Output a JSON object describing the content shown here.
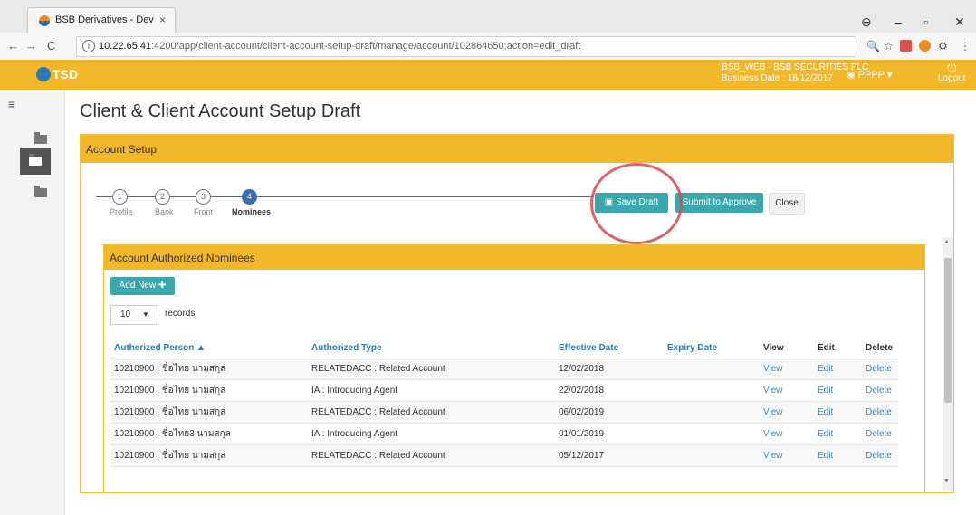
{
  "browser": {
    "tab_title": "BSB Derivatives - Dev",
    "tab_close": "×",
    "url_host": "10.22.65.41",
    "url_path": ":4200/app/client-account/client-account-setup-draft/manage/account/102864650;action=edit_draft",
    "window_controls": [
      "⊖",
      "–",
      "▫",
      "✕"
    ]
  },
  "header": {
    "logo_text": "TSD",
    "company_name": "BSB_WEB - BSB SECURITIES PLC",
    "business_date": "Business Date : 18/12/2017",
    "user": "PPPP",
    "logout_label": "Logout"
  },
  "sidebar": {
    "menu_icon": "≡",
    "active_index": 1
  },
  "page_title": "Client & Client Account Setup Draft",
  "account_setup": {
    "panel_title": "Account Setup",
    "steps": [
      {
        "number": "1",
        "label": "Profile"
      },
      {
        "number": "2",
        "label": "Bank"
      },
      {
        "number": "3",
        "label": "Front"
      },
      {
        "number": "4",
        "label": "Nominees"
      }
    ],
    "active_step": 4,
    "buttons": {
      "save_draft": "Save Draft",
      "submit": "Submit to Approve",
      "close": "Close"
    }
  },
  "nominees": {
    "panel_title": "Account Authorized Nominees",
    "add_new": "Add New",
    "page_length": "10",
    "records_label": "records",
    "columns": [
      "Autherized Person",
      "Authorized Type",
      "Effective Date",
      "Expiry Date",
      "View",
      "Edit",
      "Delete"
    ],
    "rows": [
      {
        "person": "10210900 : ชื่อไทย นามสกุล",
        "type": "RELATEDACC : Related Account",
        "effective": "12/02/2018",
        "expiry": "",
        "view": "View",
        "edit": "Edit",
        "delete": "Delete"
      },
      {
        "person": "10210900 : ชื่อไทย นามสกุล",
        "type": "IA : Introducing Agent",
        "effective": "22/02/2018",
        "expiry": "",
        "view": "View",
        "edit": "Edit",
        "delete": "Delete"
      },
      {
        "person": "10210900 : ชื่อไทย นามสกุล",
        "type": "RELATEDACC : Related Account",
        "effective": "06/02/2019",
        "expiry": "",
        "view": "View",
        "edit": "Edit",
        "delete": "Delete"
      },
      {
        "person": "10210900 : ชื่อไทย3 นามสกุล",
        "type": "IA : Introducing Agent",
        "effective": "01/01/2019",
        "expiry": "",
        "view": "View",
        "edit": "Edit",
        "delete": "Delete"
      },
      {
        "person": "10210900 : ชื่อไทย นามสกุล",
        "type": "RELATEDACC : Related Account",
        "effective": "05/12/2017",
        "expiry": "",
        "view": "View",
        "edit": "Edit",
        "delete": "Delete"
      }
    ]
  },
  "colors": {
    "header_yellow": "#f3b72a",
    "teal_button": "#3aa8ad",
    "link_blue": "#2b79b0",
    "annotation_red": "#d64a4a"
  }
}
